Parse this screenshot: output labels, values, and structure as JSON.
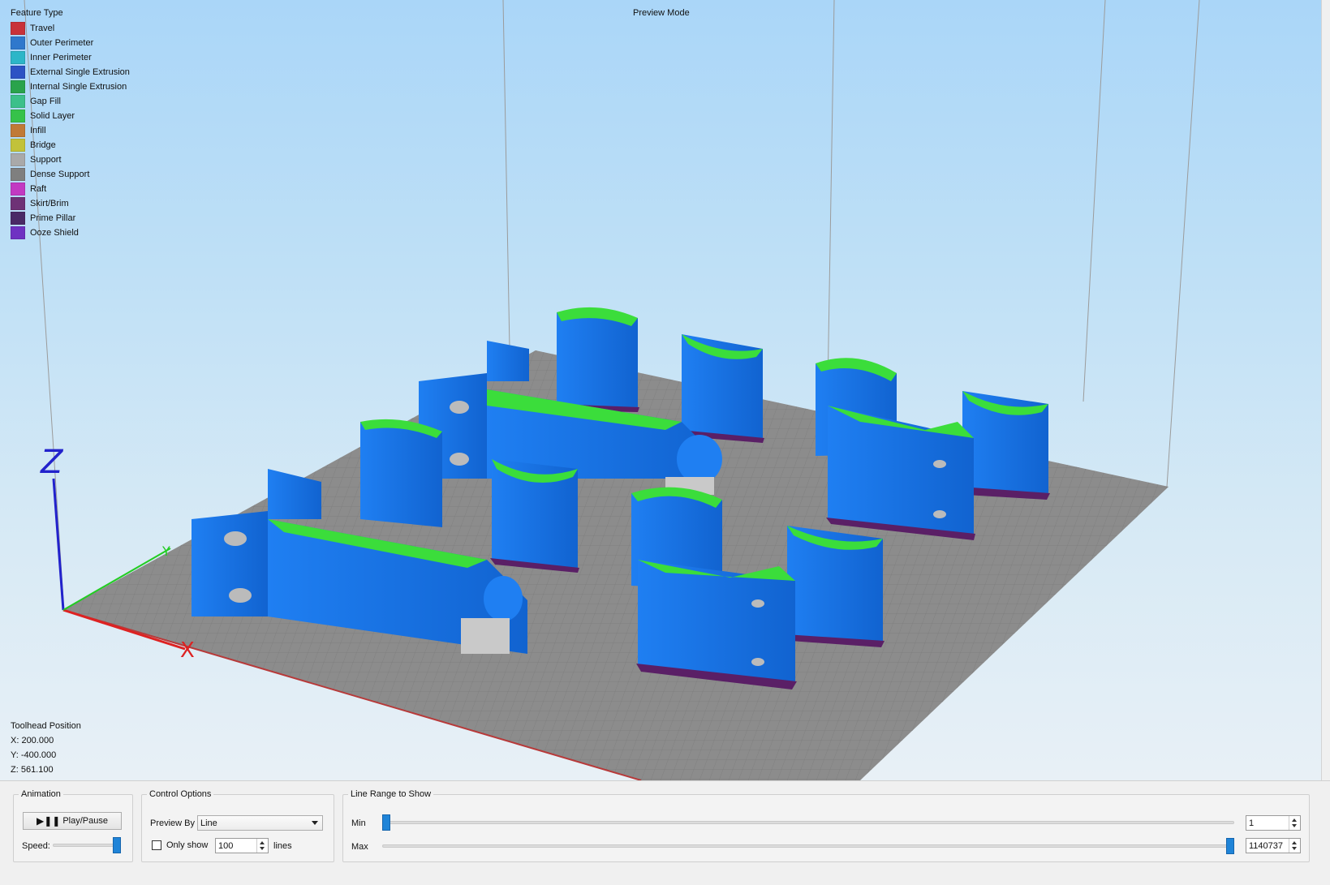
{
  "viewport": {
    "mode_label": "Preview Mode",
    "axis_labels": {
      "x": "X",
      "y": "Y",
      "z": "Z"
    }
  },
  "legend": {
    "title": "Feature Type",
    "items": [
      {
        "label": "Travel",
        "color": "#c8323a"
      },
      {
        "label": "Outer Perimeter",
        "color": "#2f78cc"
      },
      {
        "label": "Inner Perimeter",
        "color": "#2cb6c8"
      },
      {
        "label": "External Single Extrusion",
        "color": "#2c52c4"
      },
      {
        "label": "Internal Single Extrusion",
        "color": "#2aa34c"
      },
      {
        "label": "Gap Fill",
        "color": "#3cc08a"
      },
      {
        "label": "Solid Layer",
        "color": "#36c24a"
      },
      {
        "label": "Infill",
        "color": "#c07a36"
      },
      {
        "label": "Bridge",
        "color": "#c2c23a"
      },
      {
        "label": "Support",
        "color": "#a9a9a9"
      },
      {
        "label": "Dense Support",
        "color": "#7f7f7f"
      },
      {
        "label": "Raft",
        "color": "#c23ac2"
      },
      {
        "label": "Skirt/Brim",
        "color": "#6e3276"
      },
      {
        "label": "Prime Pillar",
        "color": "#4a2a66"
      },
      {
        "label": "Ooze Shield",
        "color": "#6f32c2"
      }
    ]
  },
  "toolhead": {
    "title": "Toolhead Position",
    "x": "X: 200.000",
    "y": "Y: -400.000",
    "z": "Z: 561.100"
  },
  "animation": {
    "title": "Animation",
    "play_pause_label": "Play/Pause",
    "speed_label": "Speed:",
    "speed_level": 1.0
  },
  "control_options": {
    "title": "Control Options",
    "preview_by_label": "Preview By",
    "preview_by_value": "Line",
    "only_show_label": "Only show",
    "only_show_checked": false,
    "only_show_value": "100",
    "lines_label": "lines"
  },
  "line_range": {
    "title": "Line Range to Show",
    "min_label": "Min",
    "max_label": "Max",
    "min_value": "1",
    "max_value": "1140737",
    "min_fraction": 0.0,
    "max_fraction": 1.0
  },
  "colors": {
    "part_blue": "#1a6fe0",
    "part_top_green": "#3bdd3b",
    "bed_gray": "#8c8c8c",
    "brim_purple": "#5a1f66"
  }
}
